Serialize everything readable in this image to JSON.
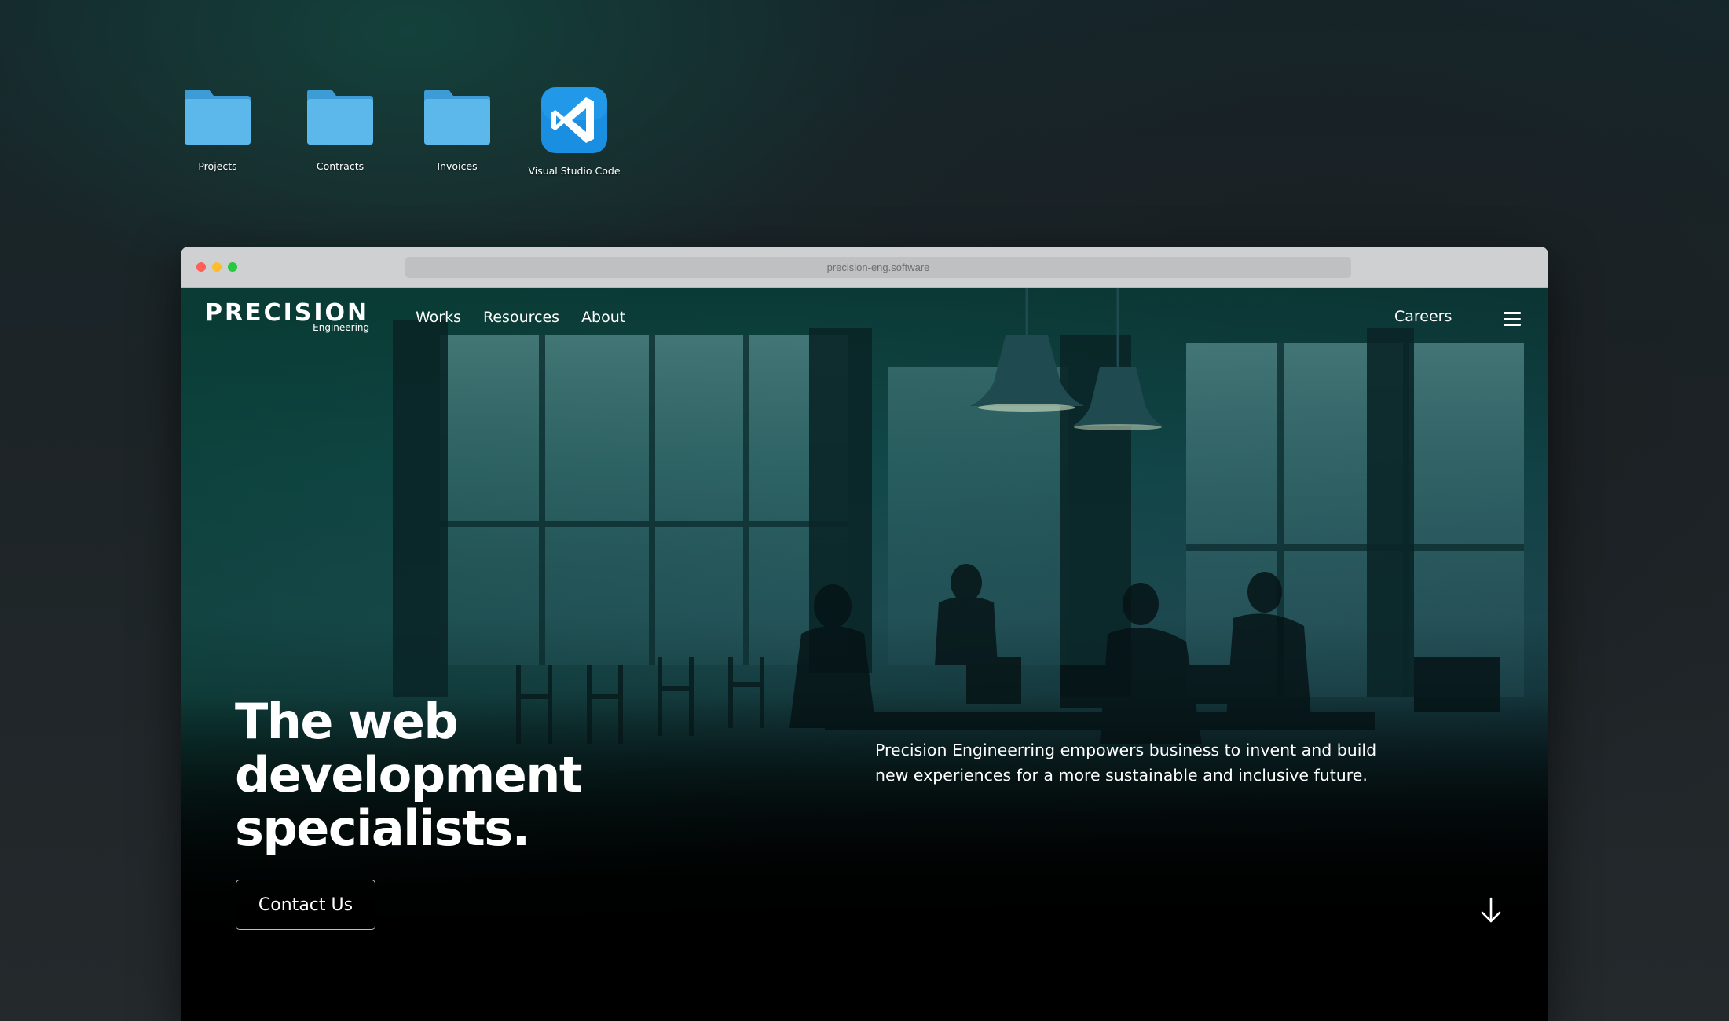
{
  "desktop": {
    "icons": [
      {
        "label": "Projects",
        "icon": "folder-icon"
      },
      {
        "label": "Contracts",
        "icon": "folder-icon"
      },
      {
        "label": "Invoices",
        "icon": "folder-icon"
      },
      {
        "label": "Visual Studio Code",
        "icon": "vscode-icon"
      }
    ]
  },
  "browser": {
    "url": "precision-eng.software",
    "traffic_lights": [
      "close",
      "minimize",
      "zoom"
    ]
  },
  "site": {
    "logo": {
      "main": "PRECISION",
      "sub": "Engineering"
    },
    "nav": {
      "links": [
        "Works",
        "Resources",
        "About"
      ],
      "careers": "Careers",
      "menu_icon": "hamburger-menu-icon"
    },
    "hero": {
      "headline_line1": "The web development",
      "headline_line2": "specialists.",
      "description": "Precision Engineerring empowers business to invent and build new experiences for a more sustainable and inclusive future.",
      "cta": "Contact Us",
      "scroll_icon": "arrow-down-icon"
    }
  },
  "colors": {
    "folder": "#5cb8ea",
    "vscode": "#1a8ee0",
    "accent_teal": "#1aa08a",
    "traffic_red": "#ff5f57",
    "traffic_yellow": "#febc2e",
    "traffic_green": "#28c840"
  }
}
